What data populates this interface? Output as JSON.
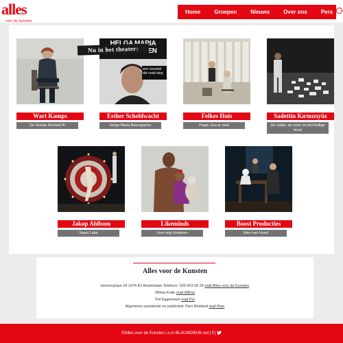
{
  "logo": {
    "text": "alles",
    "subtitle": "voor de kunsten"
  },
  "nav": {
    "items": [
      "Home",
      "Groepen",
      "Nieuws",
      "Over ons",
      "Pers"
    ]
  },
  "banner": "Nu in het theater:",
  "productions": [
    {
      "name": "Wart Kamps",
      "show": "De Goede Richard III"
    },
    {
      "name": "Esther Scheldwacht",
      "show": "Helga Maria Baumgartes",
      "poster_text": "HELGA MARIA BAUMGARTEN",
      "poster_caption": "een voorstel die nooit stop"
    },
    {
      "name": "Felkes Huis",
      "show": "Papje, hou je muil"
    },
    {
      "name": "Sadettin Kırmızıyüz",
      "show": "De vader, de zoon en het heilige feest"
    },
    {
      "name": "Jakop Ahlbom",
      "show": "Swan Lake"
    },
    {
      "name": "Likeminds",
      "show": "Voor mijn kinderen"
    },
    {
      "name": "Boost Producties",
      "show": "Man met Hoed"
    }
  ],
  "info": {
    "title": "Alles voor de Kunsten",
    "address": "Hemonylaan 24 1074 BJ Amsterdam Telefoon: 020 423 58 26",
    "address_link": "mail Alles voor de Kunsten",
    "wilma": "Wilma Kuite",
    "wilma_link": "mail Wilma",
    "pol": "Pol Eggermont",
    "pol_link": "mail Pol",
    "assist": "Algemene assistentie en publiciteit: Pien Roeland",
    "assist_link": "mail Pien"
  },
  "footer": {
    "text": "©Alles voor de Kunsten i.s.m",
    "link": "BLAUWDRUK.net"
  },
  "colors": {
    "accent": "#e30613",
    "grey": "#737373",
    "background": "#ececec"
  }
}
